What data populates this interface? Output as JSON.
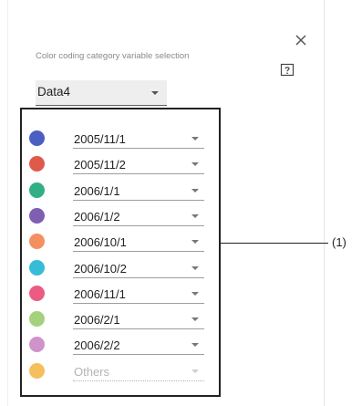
{
  "panel": {
    "icons": {
      "close": "close-icon",
      "help": "help-icon"
    },
    "section_label": "Color coding category variable selection",
    "category_select": {
      "value": "Data4"
    }
  },
  "callout": {
    "label": "(1)"
  },
  "color_rows": [
    {
      "color": "#4a5fc1",
      "label": "2005/11/1"
    },
    {
      "color": "#e05a4b",
      "label": "2005/11/2"
    },
    {
      "color": "#33b083",
      "label": "2006/1/1"
    },
    {
      "color": "#7e5fb2",
      "label": "2006/1/2"
    },
    {
      "color": "#f39060",
      "label": "2006/10/1"
    },
    {
      "color": "#36bcd8",
      "label": "2006/10/2"
    },
    {
      "color": "#ec5b82",
      "label": "2006/11/1"
    },
    {
      "color": "#a5d17c",
      "label": "2006/2/1"
    },
    {
      "color": "#cf93c9",
      "label": "2006/2/2"
    },
    {
      "color": "#f5bf5b",
      "label": "Others",
      "disabled": true
    }
  ]
}
